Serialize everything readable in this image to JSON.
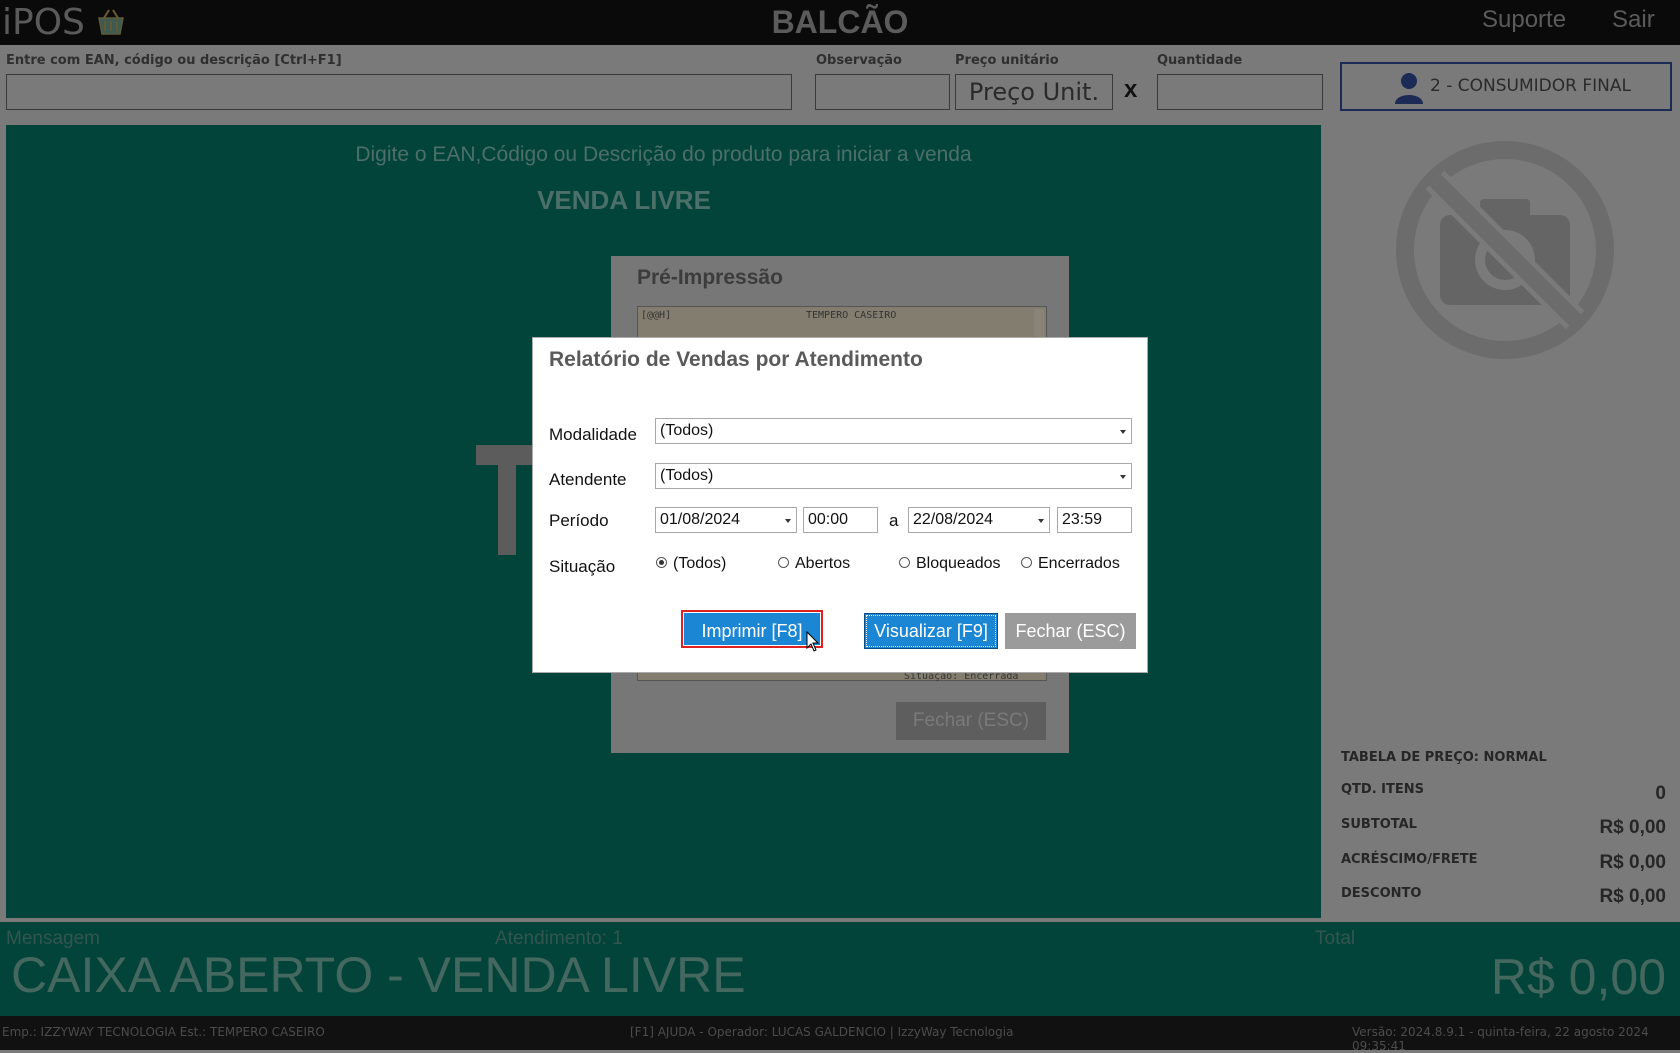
{
  "header": {
    "logo_text": "iPOS",
    "title": "BALCÃO",
    "support_label": "Suporte",
    "exit_label": "Sair"
  },
  "entry": {
    "search_label": "Entre com EAN, código ou descrição [Ctrl+F1]",
    "observation_label": "Observação",
    "unit_price_label": "Preço unitário",
    "unit_price_value": "Preço Unit.",
    "multiply_symbol": "x",
    "quantity_label": "Quantidade",
    "customer_label": "2 - CONSUMIDOR FINAL"
  },
  "main": {
    "hint": "Digite o EAN,Código ou Descrição do produto para iniciar a venda",
    "mode": "VENDA LIVRE"
  },
  "preprint": {
    "title": "Pré-Impressão",
    "line1_left": "[@@H]",
    "line1_center": "TEMPERO CASEIRO",
    "line_bottom": "Situação: Encerrada",
    "close_label": "Fechar (ESC)"
  },
  "modal": {
    "title": "Relatório de Vendas por Atendimento",
    "modalidade_label": "Modalidade",
    "modalidade_value": "(Todos)",
    "atendente_label": "Atendente",
    "atendente_value": "(Todos)",
    "periodo_label": "Período",
    "date_from": "01/08/2024",
    "time_from": "00:00",
    "range_sep": "a",
    "date_to": "22/08/2024",
    "time_to": "23:59",
    "situacao_label": "Situação",
    "situacao_options": [
      "(Todos)",
      "Abertos",
      "Bloqueados",
      "Encerrados"
    ],
    "situacao_selected": "(Todos)",
    "print_label": "Imprimir [F8]",
    "view_label": "Visualizar [F9]",
    "close_label": "Fechar (ESC)"
  },
  "totals": {
    "price_table": "TABELA DE PREÇO: NORMAL",
    "qty_label": "QTD. ITENS",
    "qty_value": "0",
    "subtotal_label": "SUBTOTAL",
    "subtotal_value": "R$ 0,00",
    "surcharge_label": "ACRÉSCIMO/FRETE",
    "surcharge_value": "R$ 0,00",
    "discount_label": "DESCONTO",
    "discount_value": "R$ 0,00"
  },
  "bottom": {
    "message_label": "Mensagem",
    "attendance_label": "Atendimento: 1",
    "total_label": "Total",
    "status": "CAIXA ABERTO - VENDA LIVRE",
    "total_value": "R$ 0,00"
  },
  "footer": {
    "company": "Emp.: IZZYWAY TECNOLOGIA  Est.: TEMPERO CASEIRO",
    "center": "[F1] AJUDA - Operador: LUCAS GALDENCIO | IzzyWay Tecnologia",
    "version": "Versão: 2024.8.9.1 - quinta-feira, 22 agosto 2024 09:35:41"
  },
  "colors": {
    "panel_green": "#02443a",
    "overlay_gray": "#7a7a7a",
    "button_blue": "#1b86d3",
    "highlight_red": "#dd2222"
  }
}
